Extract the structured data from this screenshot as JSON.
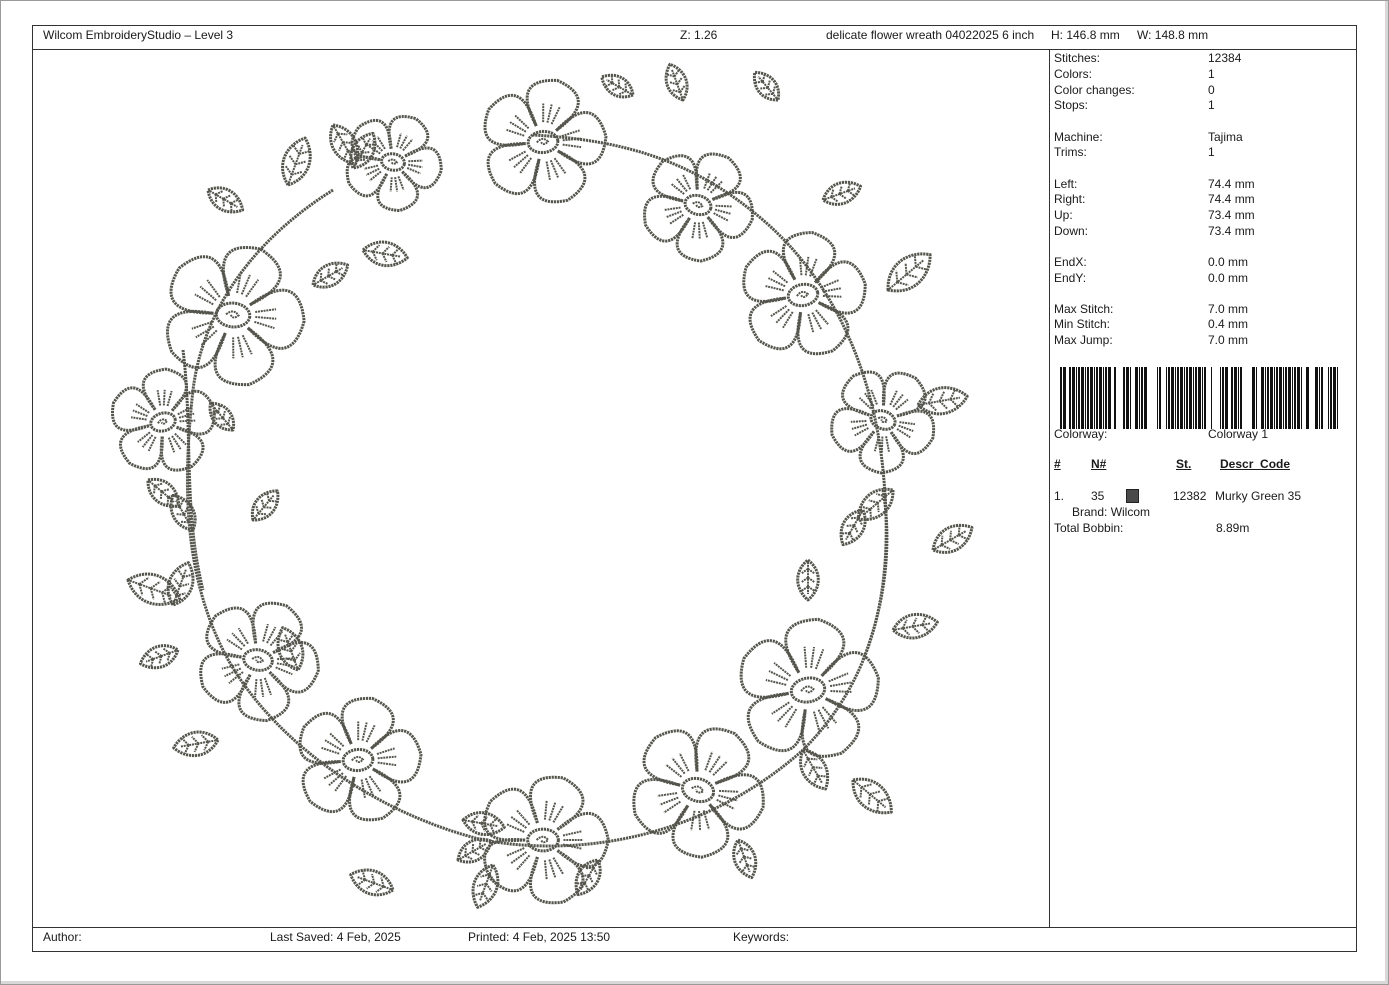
{
  "header": {
    "app_title": "Wilcom EmbroideryStudio – Level 3",
    "zoom": "Z: 1.26",
    "design_name": "delicate flower wreath 04022025 6 inch",
    "height": "H: 146.8 mm",
    "width": "W: 148.8 mm"
  },
  "stats": {
    "stitches_label": "Stitches:",
    "stitches": "12384",
    "colors_label": "Colors:",
    "colors": "1",
    "color_changes_label": "Color changes:",
    "color_changes": "0",
    "stops_label": "Stops:",
    "stops": "1",
    "machine_label": "Machine:",
    "machine": "Tajima",
    "trims_label": "Trims:",
    "trims": "1",
    "left_label": "Left:",
    "left": "74.4 mm",
    "right_label": "Right:",
    "right": "74.4 mm",
    "up_label": "Up:",
    "up": "73.4 mm",
    "down_label": "Down:",
    "down": "73.4 mm",
    "endx_label": "EndX:",
    "endx": "0.0 mm",
    "endy_label": "EndY:",
    "endy": "0.0 mm",
    "max_stitch_label": "Max Stitch:",
    "max_stitch": "7.0 mm",
    "min_stitch_label": "Min Stitch:",
    "min_stitch": "0.4 mm",
    "max_jump_label": "Max Jump:",
    "max_jump": "7.0 mm"
  },
  "colorway": {
    "label": "Colorway:",
    "value": "Colorway 1",
    "columns": {
      "num": "#",
      "n": "N#",
      "st": "St.",
      "descr": "Descr_Code"
    },
    "rows": [
      {
        "num": "1.",
        "n": "35",
        "swatch_color": "#4a4a4a",
        "st": "12382",
        "descr": "Murky Green 35"
      }
    ],
    "brand": "Brand: Wilcom",
    "total_bobbin_label": "Total Bobbin:",
    "total_bobbin": "8.89m"
  },
  "footer": {
    "author": "Author:",
    "last_saved": "Last Saved:  4 Feb, 2025",
    "printed": "Printed:  4 Feb, 2025 13:50",
    "keywords": "Keywords:"
  },
  "colors": {
    "thread": "#55554d",
    "frame": "#333333"
  },
  "design_icon": "flower-wreath-embroidery"
}
